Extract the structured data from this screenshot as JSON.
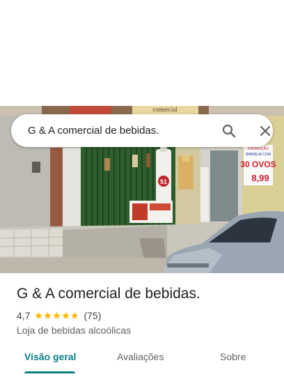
{
  "search": {
    "query": "G & A comercial de bebidas.",
    "search_icon": "search-icon",
    "close_icon": "close-icon"
  },
  "photo": {
    "sign_top": "comercial",
    "sign_right_top": "PROMOÇÃO",
    "sign_right_mid": "BANDEJA COM",
    "sign_right_big": "30 OVOS",
    "sign_right_price": "8,99",
    "bottle_label": "51"
  },
  "place": {
    "title": "G & A comercial de bebidas.",
    "rating": "4,7",
    "stars": 4.7,
    "reviews": "(75)",
    "category": "Loja de bebidas alcoólicas",
    "star_color": "#fbbc04"
  },
  "tabs": [
    {
      "label": "Visão geral",
      "active": true
    },
    {
      "label": "Avaliações",
      "active": false
    },
    {
      "label": "Sobre",
      "active": false
    }
  ],
  "colors": {
    "accent": "#0b7e87",
    "text": "#202124"
  }
}
